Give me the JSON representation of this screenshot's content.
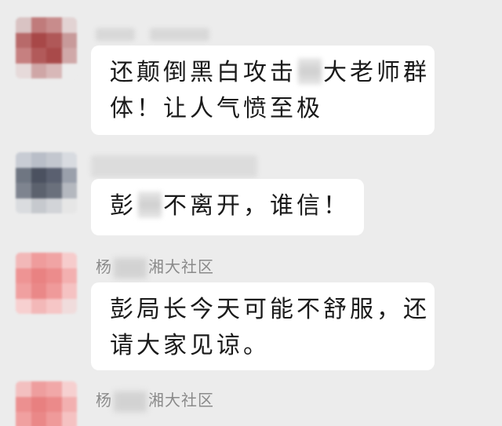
{
  "messages": [
    {
      "sender": "",
      "lines": [
        "还颠倒黑白攻击",
        "大老师群",
        "体！让人气愤至极"
      ]
    },
    {
      "sender": "",
      "lines": [
        "彭",
        "不离开，谁信！"
      ]
    },
    {
      "sender_prefix": "杨",
      "sender_suffix": "湘大社区",
      "lines": [
        "彭局长今天可能不舒服，还",
        "请大家见谅。"
      ]
    },
    {
      "sender_prefix": "杨",
      "sender_suffix": "湘大社区"
    }
  ],
  "colors": {
    "background": "#ececec",
    "bubble": "#ffffff",
    "sender_text": "#8a8a8a",
    "message_text": "#1a1a1a"
  },
  "icons": {
    "avatar_1": "blurred-avatar-red",
    "avatar_2": "blurred-avatar-gray",
    "avatar_3": "blurred-avatar-pink",
    "avatar_4": "blurred-avatar-pink"
  }
}
